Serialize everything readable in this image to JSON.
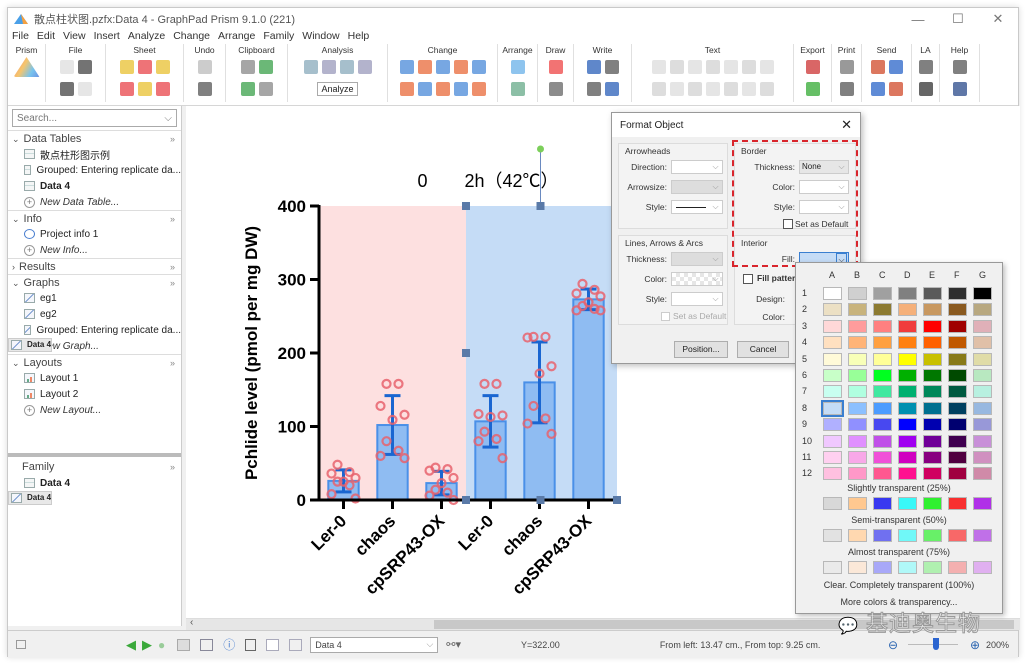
{
  "window": {
    "title": "散点柱状图.pzfx:Data 4 - GraphPad Prism 9.1.0 (221)",
    "controls": [
      "—",
      "☐",
      "✕"
    ]
  },
  "menu": [
    "File",
    "Edit",
    "View",
    "Insert",
    "Analyze",
    "Change",
    "Arrange",
    "Family",
    "Window",
    "Help"
  ],
  "ribbon": {
    "groups": [
      "Prism",
      "File",
      "Sheet",
      "Undo",
      "Clipboard",
      "Analysis",
      "Change",
      "Arrange",
      "Draw",
      "Write",
      "Text",
      "Export",
      "Print",
      "Send",
      "LA",
      "Help"
    ],
    "analyze_label": "Analyze"
  },
  "navigator": {
    "search_placeholder": "Search...",
    "sections": [
      {
        "label": "Data Tables",
        "expanded": true,
        "items": [
          {
            "label": "散点柱形图示例",
            "bold": false,
            "icon": "table-icon"
          },
          {
            "label": "Grouped: Entering replicate da...",
            "bold": false,
            "icon": "table-icon"
          },
          {
            "label": "Data 4",
            "bold": true,
            "icon": "table-icon"
          },
          {
            "label": "New Data Table...",
            "new": true
          }
        ]
      },
      {
        "label": "Info",
        "expanded": true,
        "items": [
          {
            "label": "Project info 1",
            "icon": "info-icon"
          },
          {
            "label": "New Info...",
            "new": true
          }
        ]
      },
      {
        "label": "Results",
        "expanded": false,
        "items": []
      },
      {
        "label": "Graphs",
        "expanded": true,
        "items": [
          {
            "label": "eg1",
            "icon": "graph-icon"
          },
          {
            "label": "eg2",
            "icon": "graph-icon"
          },
          {
            "label": "Grouped: Entering replicate da...",
            "icon": "graph-icon"
          },
          {
            "label": "Data 4",
            "bold": true,
            "selected": true,
            "icon": "graph-icon"
          },
          {
            "label": "New Graph...",
            "new": true
          }
        ]
      },
      {
        "label": "Layouts",
        "expanded": true,
        "items": [
          {
            "label": "Layout 1",
            "icon": "layout-icon"
          },
          {
            "label": "Layout 2",
            "icon": "layout-icon"
          },
          {
            "label": "New Layout...",
            "new": true
          }
        ]
      }
    ],
    "family": {
      "label": "Family",
      "items": [
        {
          "label": "Data 4",
          "icon": "table-icon"
        },
        {
          "label": "Data 4",
          "icon": "graph-icon",
          "selected": true
        }
      ]
    }
  },
  "chart_data": {
    "type": "bar",
    "title": "",
    "group_labels": [
      "0",
      "2h（42℃）"
    ],
    "categories": [
      "Ler-0",
      "chaos",
      "cpSRP43-OX",
      "Ler-0",
      "chaos",
      "cpSRP43-OX"
    ],
    "values": [
      26,
      102,
      23,
      107,
      160,
      273
    ],
    "error_sd": [
      15,
      40,
      16,
      35,
      55,
      14
    ],
    "points": [
      [
        48,
        38,
        36,
        30,
        25,
        25,
        20,
        8,
        2
      ],
      [
        158,
        158,
        128,
        116,
        109,
        80,
        67,
        60,
        57
      ],
      [
        44,
        42,
        40,
        30,
        23,
        14,
        10,
        6,
        0
      ],
      [
        158,
        158,
        117,
        115,
        113,
        93,
        83,
        80,
        57
      ],
      [
        222,
        222,
        221,
        182,
        172,
        128,
        111,
        104,
        90
      ],
      [
        294,
        286,
        281,
        277,
        269,
        264,
        260,
        258,
        258
      ]
    ],
    "ylabel": "Pchlide level (pmol per mg DW)",
    "xlabel": "",
    "ylim": [
      0,
      400
    ],
    "yticks": [
      0,
      100,
      200,
      300,
      400
    ],
    "background_colors": [
      "#fde0e0",
      "#c5dcf6"
    ],
    "bar_color": "#8fbcf2",
    "bar_edge": "#4a90e8",
    "point_color": "#e8636d",
    "error_color": "#1a66d1"
  },
  "format_dialog": {
    "title": "Format Object",
    "arrowheads": {
      "title": "Arrowheads",
      "direction_label": "Direction:",
      "arrowsize_label": "Arrowsize:",
      "style_label": "Style:"
    },
    "lines": {
      "title": "Lines, Arrows & Arcs",
      "thickness_label": "Thickness:",
      "color_label": "Color:",
      "style_label": "Style:",
      "default_label": "Set as Default"
    },
    "border": {
      "title": "Border",
      "thickness_label": "Thickness:",
      "thickness_value": "None",
      "color_label": "Color:",
      "style_label": "Style:",
      "default_label": "Set as Default"
    },
    "interior": {
      "title": "Interior",
      "fill_label": "Fill:",
      "fill_color": "#c5dcf6",
      "pattern_label": "Fill pattern",
      "design_label": "Design:",
      "color_label": "Color:"
    },
    "position_button": "Position...",
    "cancel_button": "Cancel"
  },
  "palette": {
    "columns": [
      "A",
      "B",
      "C",
      "D",
      "E",
      "F",
      "G"
    ],
    "rows": [
      "1",
      "2",
      "3",
      "4",
      "5",
      "6",
      "7",
      "8",
      "9",
      "10",
      "11",
      "12"
    ],
    "colors": [
      [
        "#ffffff",
        "#d0d0d0",
        "#a0a0a0",
        "#808080",
        "#5a5a5a",
        "#2e2e2e",
        "#000000"
      ],
      [
        "#ece0c4",
        "#c8b37c",
        "#8c7a30",
        "#f5b07a",
        "#c89860",
        "#8a5a20",
        "#b8a880"
      ],
      [
        "#ffd8d8",
        "#ff9c9c",
        "#ff8080",
        "#f03c3c",
        "#ff0000",
        "#a00000",
        "#e0b0b8"
      ],
      [
        "#ffe0c0",
        "#ffb478",
        "#ffa040",
        "#ff8010",
        "#ff6000",
        "#c05800",
        "#e0c0a8"
      ],
      [
        "#fffad8",
        "#f8ffb8",
        "#ffff98",
        "#ffff00",
        "#c8c000",
        "#887a18",
        "#e0dca8"
      ],
      [
        "#c8ffc8",
        "#98ff98",
        "#00ff20",
        "#00b000",
        "#007800",
        "#004a00",
        "#b8e8c0"
      ],
      [
        "#c8fff0",
        "#b0ffe0",
        "#40e8a0",
        "#00b070",
        "#00885a",
        "#005a40",
        "#b8f0e0"
      ],
      [
        "#c5dcf6",
        "#8cc0ff",
        "#4c9cff",
        "#0090b0",
        "#007090",
        "#004060",
        "#98b8e0"
      ],
      [
        "#b0b0ff",
        "#9090ff",
        "#4848f0",
        "#0000ff",
        "#0000b0",
        "#000070",
        "#9898d8"
      ],
      [
        "#f0c8ff",
        "#e090ff",
        "#c050e8",
        "#a000f0",
        "#700098",
        "#400050",
        "#c890d8"
      ],
      [
        "#ffd0f0",
        "#f8a8e8",
        "#f050d8",
        "#d000c0",
        "#880080",
        "#500040",
        "#d090c0"
      ],
      [
        "#ffc0e0",
        "#ff98c8",
        "#ff5890",
        "#ff1090",
        "#d00060",
        "#a00040",
        "#d08aa8"
      ]
    ],
    "selected": "A8",
    "slightly_label": "Slightly transparent (25%)",
    "slightly": [
      "#d8d8d8",
      "#ffc890",
      "#3838f0",
      "#38f8f8",
      "#30f030",
      "#f83030",
      "#b030e8"
    ],
    "semi_label": "Semi-transparent (50%)",
    "semi": [
      "#e2e2e2",
      "#ffd8b0",
      "#7070f0",
      "#70f8f8",
      "#68f068",
      "#f86868",
      "#c070e8"
    ],
    "almost_label": "Almost transparent (75%)",
    "almost": [
      "#eaeaea",
      "#fbe8d8",
      "#a8a8f8",
      "#b0f8f8",
      "#b0f0b0",
      "#f4b0b0",
      "#e0b0f0"
    ],
    "clear_label": "Clear. Completely transparent (100%)",
    "more_label": "More colors & transparency..."
  },
  "statusbar": {
    "sheet_select": "Data 4",
    "y_readout": "Y=322.00",
    "position_readout": "From left: 13.47 cm., From top: 9.25 cm.",
    "zoom": "200%",
    "zoom_fraction": 0.55
  },
  "watermark": "基迪奥生物"
}
